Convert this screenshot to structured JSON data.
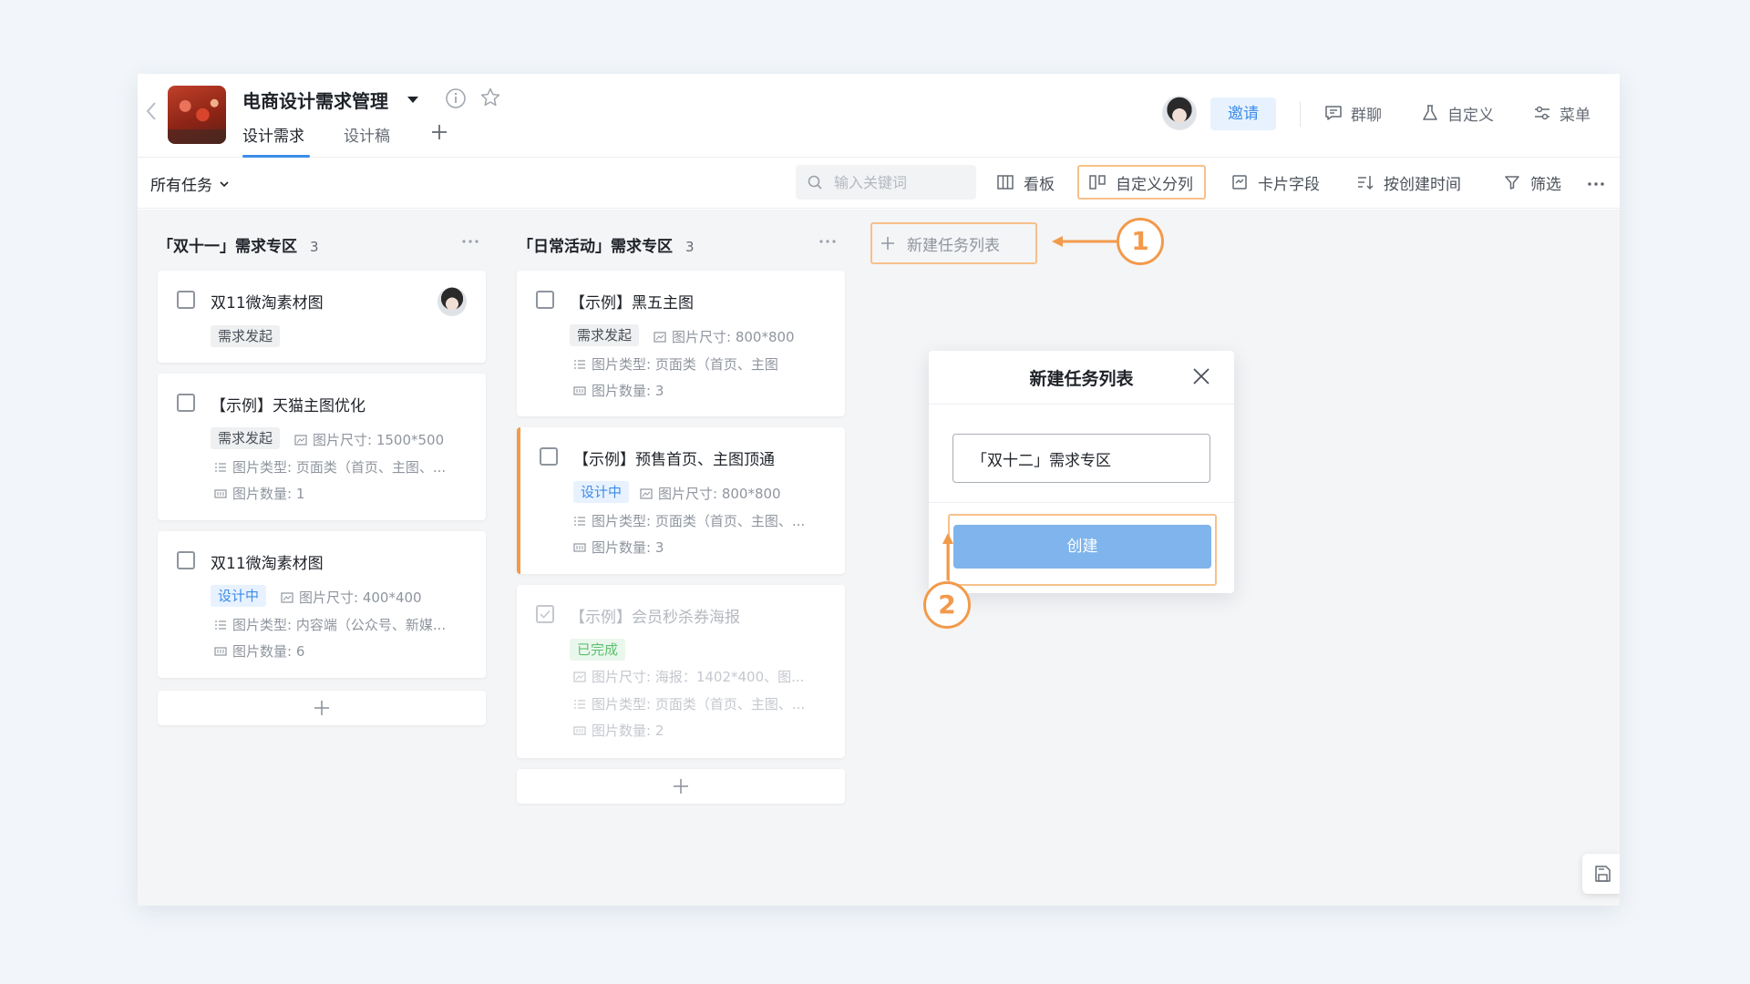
{
  "header": {
    "project_title": "电商设计需求管理",
    "tabs": [
      {
        "label": "设计需求",
        "active": true
      },
      {
        "label": "设计稿",
        "active": false
      }
    ],
    "invite_label": "邀请",
    "actions": [
      {
        "label": "群聊",
        "icon": "chat-icon"
      },
      {
        "label": "自定义",
        "icon": "flask-icon"
      },
      {
        "label": "菜单",
        "icon": "menu-sliders-icon"
      }
    ]
  },
  "toolbar": {
    "task_filter": "所有任务",
    "search_placeholder": "输入关键词",
    "buttons": [
      {
        "label": "看板",
        "icon": "board-icon"
      },
      {
        "label": "自定义分列",
        "icon": "columns-icon"
      },
      {
        "label": "卡片字段",
        "icon": "card-field-icon"
      },
      {
        "label": "按创建时间",
        "icon": "sort-icon"
      },
      {
        "label": "筛选",
        "icon": "filter-icon"
      }
    ]
  },
  "board": {
    "columns": [
      {
        "title": "「双十一」需求专区",
        "count": "3",
        "cards": [
          {
            "title": "双11微淘素材图",
            "tag": "需求发起"
          },
          {
            "title": "【示例】天猫主图优化",
            "tag": "需求发起",
            "size": "图片尺寸: 1500*500",
            "type": "图片类型: 页面类（首页、主图、...",
            "count": "图片数量: 1"
          },
          {
            "title": "双11微淘素材图",
            "tag": "设计中",
            "size": "图片尺寸: 400*400",
            "type": "图片类型: 内容端（公众号、新媒...",
            "count": "图片数量: 6"
          }
        ]
      },
      {
        "title": "「日常活动」需求专区",
        "count": "3",
        "cards": [
          {
            "title": "【示例】黑五主图",
            "tag": "需求发起",
            "size": "图片尺寸: 800*800",
            "type": "图片类型: 页面类（首页、主图",
            "count": "图片数量: 3"
          },
          {
            "title": "【示例】预售首页、主图顶通",
            "tag": "设计中",
            "size": "图片尺寸: 800*800",
            "type": "图片类型: 页面类（首页、主图、...",
            "count": "图片数量: 3"
          },
          {
            "title": "【示例】会员秒杀券海报",
            "tag": "已完成",
            "size": "图片尺寸: 海报：1402*400、图...",
            "type": "图片类型: 页面类（首页、主图、...",
            "count": "图片数量: 2"
          }
        ]
      }
    ],
    "new_list_label": "新建任务列表"
  },
  "popup": {
    "title": "新建任务列表",
    "input_value": "「双十二」需求专区",
    "create_label": "创建"
  },
  "annotations": {
    "one": "1",
    "two": "2"
  },
  "colors": {
    "accent_blue": "#3c8ce8",
    "annotation_orange": "#f29a4b",
    "create_button": "#7fb4ed"
  }
}
